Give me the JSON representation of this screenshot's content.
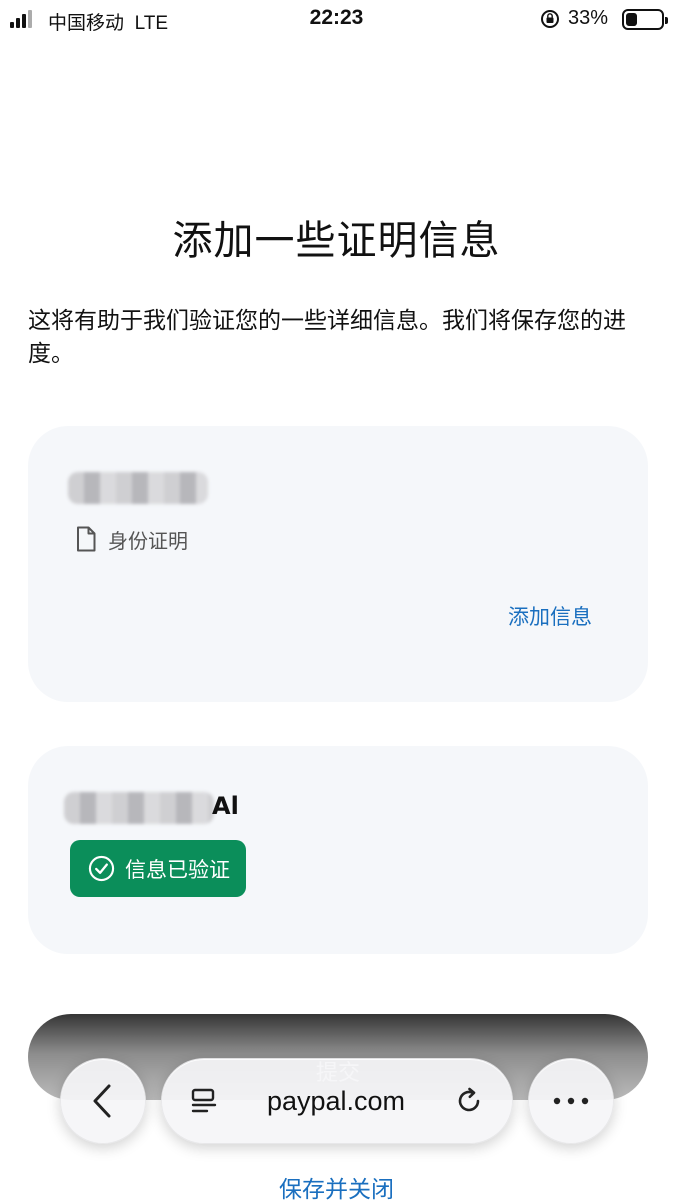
{
  "status_bar": {
    "carrier": "中国移动",
    "network": "LTE",
    "time": "22:23",
    "battery_percent": "33%"
  },
  "page": {
    "title": "添加一些证明信息",
    "description": "这将有助于我们验证您的一些详细信息。我们将保存您的进度。"
  },
  "cards": [
    {
      "name_visible_part": "",
      "document_label": "身份证明",
      "document_icon": "document-icon",
      "action_label": "添加信息"
    },
    {
      "name_visible_part": "Al",
      "status_badge": "信息已验证",
      "status_icon": "check-circle-icon",
      "badge_color": "#0b8e5a"
    }
  ],
  "actions": {
    "submit_label": "提交",
    "save_close_label": "保存并关闭"
  },
  "browser": {
    "url": "paypal.com",
    "back_icon": "chevron-left-icon",
    "reader_icon": "page-menu-icon",
    "reload_icon": "reload-icon",
    "more_icon": "more-dots-icon"
  },
  "colors": {
    "link": "#1a6fbf",
    "card_background": "#f5f7fa",
    "button": "#000000"
  }
}
